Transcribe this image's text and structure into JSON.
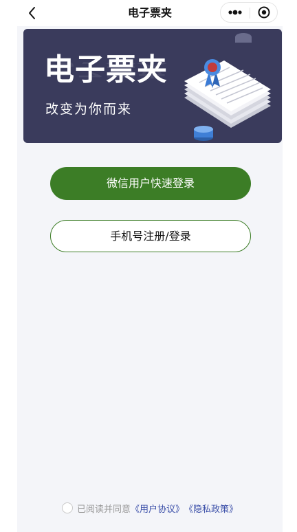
{
  "navbar": {
    "title": "电子票夹",
    "back_icon": "chevron-left-icon",
    "more_icon": "more-dots-icon",
    "close_icon": "target-circle-icon"
  },
  "banner": {
    "title": "电子票夹",
    "subtitle": "改变为你而来",
    "background_color": "#3a3b5c",
    "art_icon": "certificate-stack-icon"
  },
  "buttons": {
    "wechat_login": "微信用户快速登录",
    "phone_login": "手机号注册/登录",
    "primary_color": "#3c7d26"
  },
  "agreement": {
    "prefix": "已阅读并同意",
    "user_agreement": "《用户协议》",
    "privacy_policy": "《隐私政策》",
    "checked": false,
    "link_color": "#3a4ea8"
  }
}
